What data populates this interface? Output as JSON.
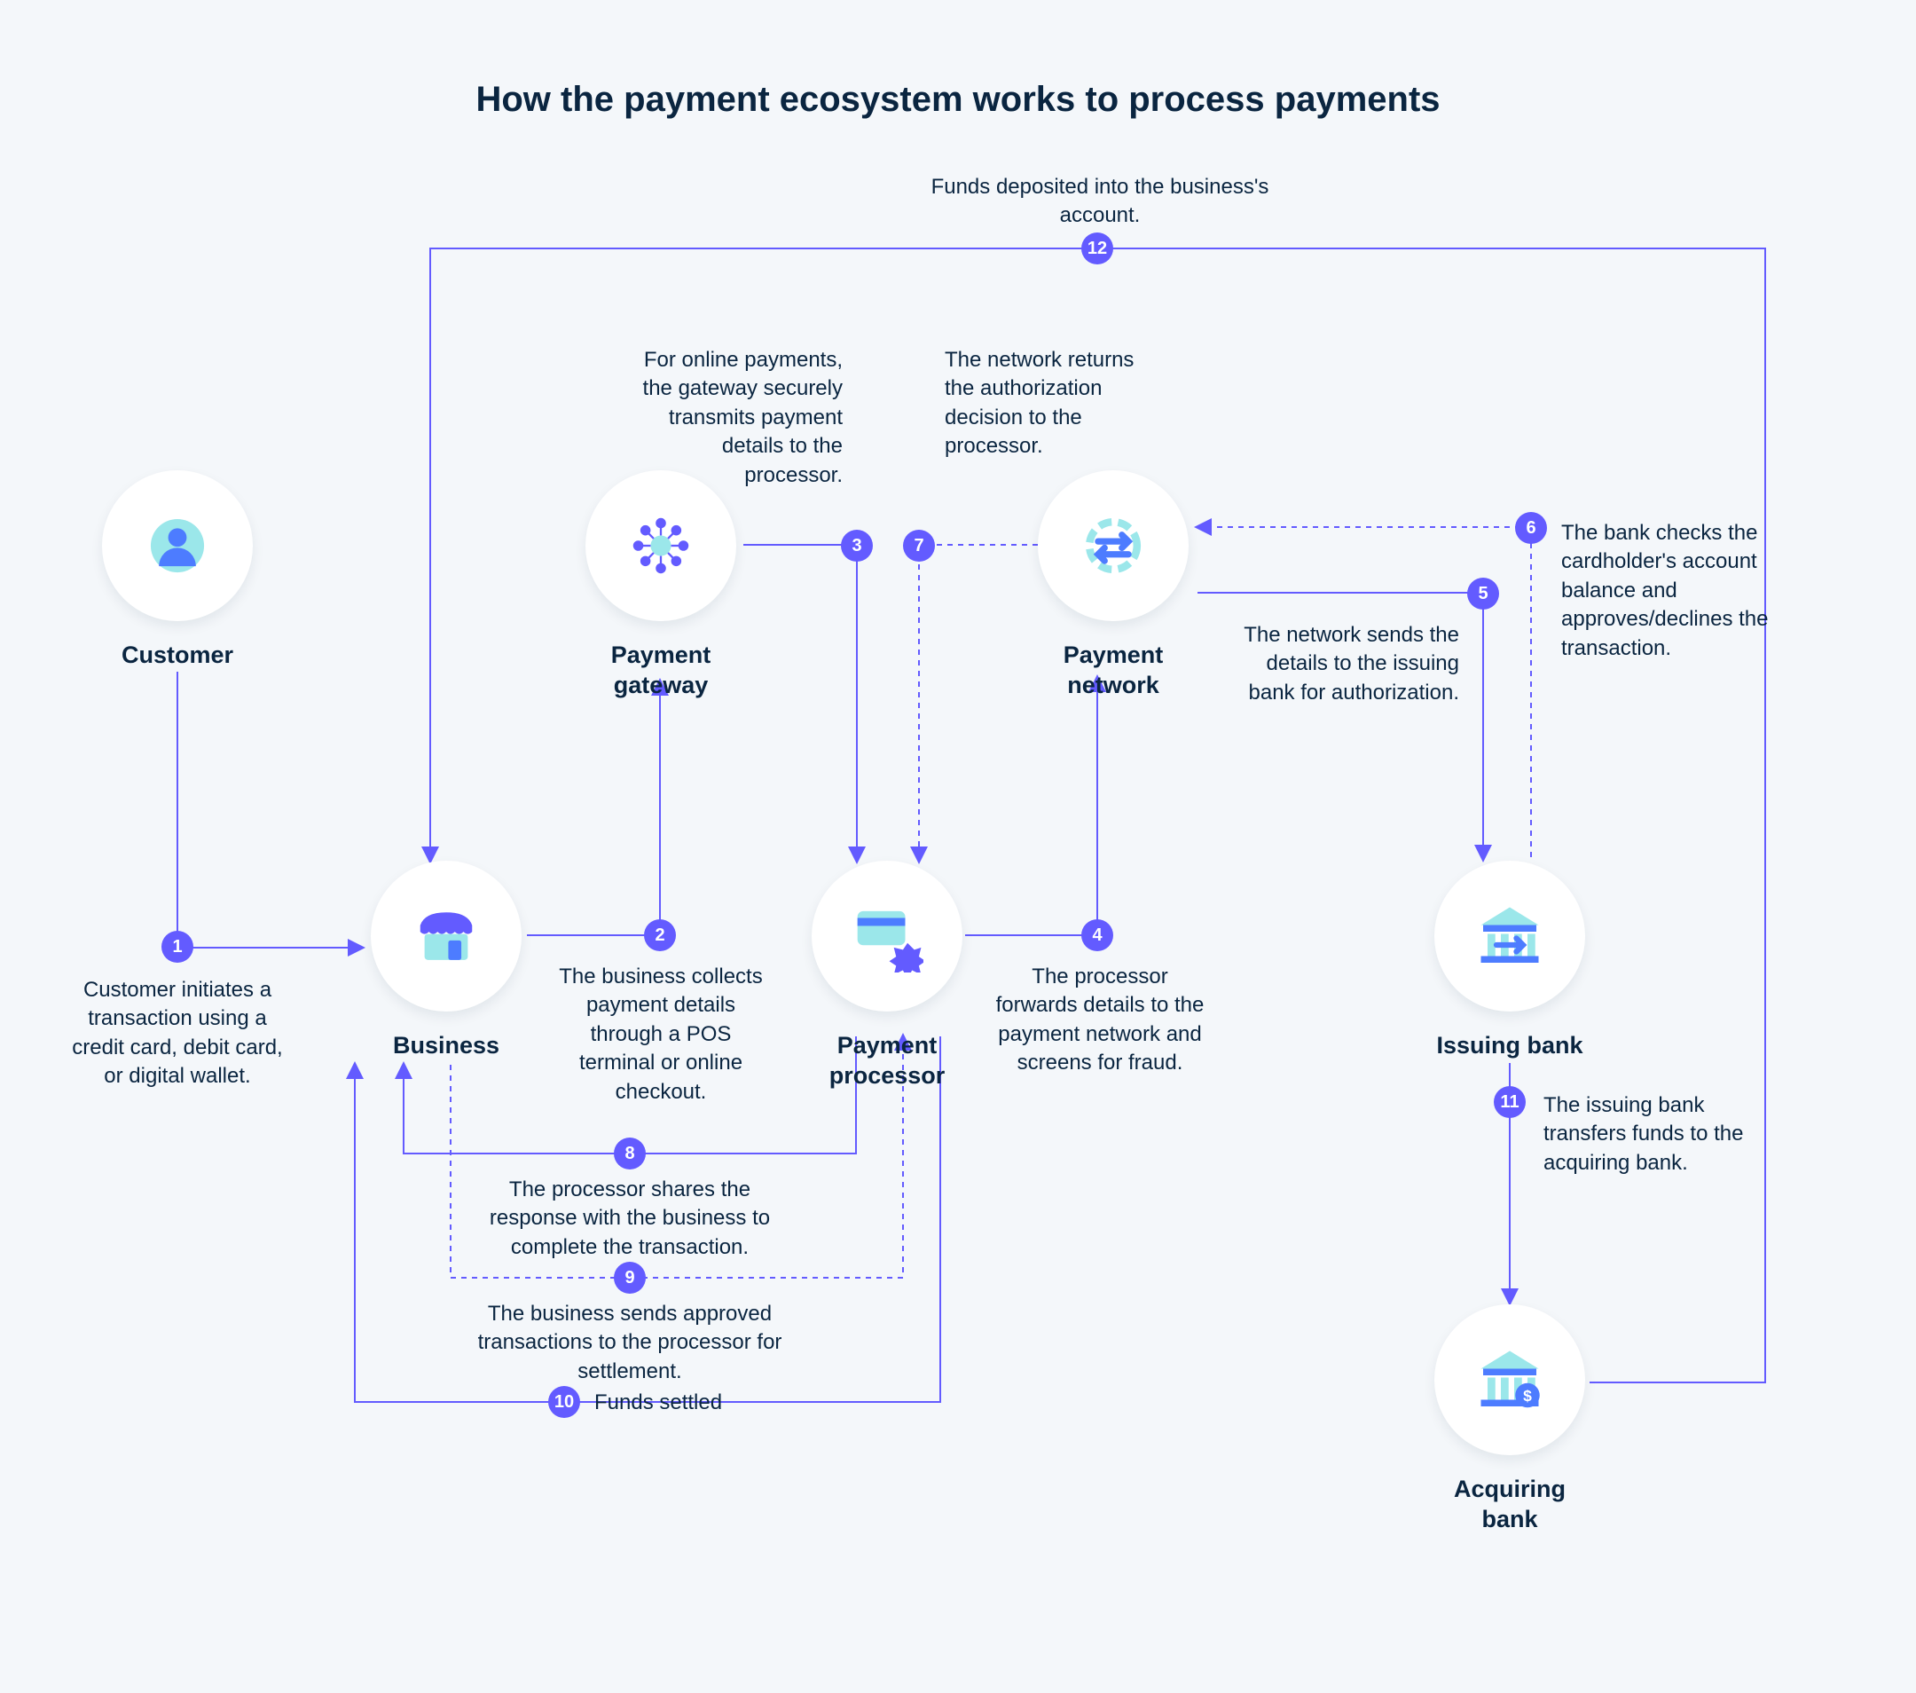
{
  "title": "How the payment ecosystem works to process payments",
  "nodes": {
    "customer": "Customer",
    "business": "Business",
    "payment_gateway": "Payment\ngateway",
    "payment_processor": "Payment processor",
    "payment_network": "Payment\nnetwork",
    "issuing_bank": "Issuing bank",
    "acquiring_bank": "Acquiring bank"
  },
  "steps": {
    "1": "Customer initiates a transaction using a credit card, debit card, or digital wallet.",
    "2": "The business collects payment details through a POS terminal or online checkout.",
    "3": "For online payments, the gateway securely transmits payment details to the processor.",
    "4": "The processor forwards details to the payment network and screens for fraud.",
    "5": "The network sends the details to the issuing bank for authorization.",
    "6": "The bank checks the cardholder's account balance and approves/declines the transaction.",
    "7": "The network returns the authorization decision to the processor.",
    "8": "The processor shares the response with the business to complete the transaction.",
    "9": "The business sends approved transactions to the processor for settlement.",
    "10": "Funds settled",
    "11": "The issuing bank transfers funds to the acquiring bank.",
    "12": "Funds deposited into the business's account."
  },
  "badges": [
    "1",
    "2",
    "3",
    "4",
    "5",
    "6",
    "7",
    "8",
    "9",
    "10",
    "11",
    "12"
  ],
  "colors": {
    "accent": "#635bff",
    "cyan": "#4fdadf",
    "ink": "#0a2540"
  }
}
